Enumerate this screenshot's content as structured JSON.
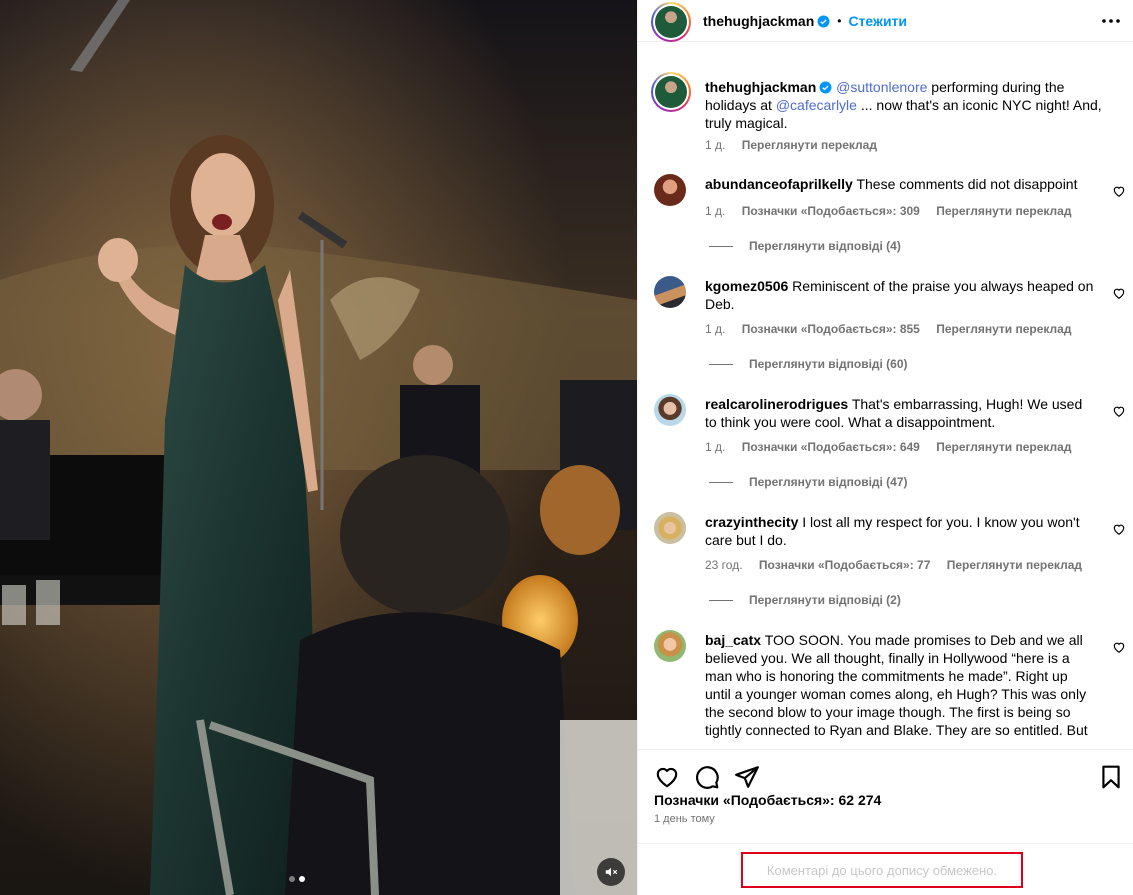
{
  "post": {
    "username": "thehughjackman",
    "follow_label": "Стежити",
    "caption": {
      "mention_1": "@suttonlenore",
      "text_1": " performing during the holidays at ",
      "mention_2": "@cafecarlyle",
      "text_2": " ... now that's an iconic NYC night! And, truly magical.",
      "time": "1 д.",
      "translate": "Переглянути переклад"
    }
  },
  "comments": [
    {
      "username": "abundanceofaprilkelly",
      "text": "These comments did not disappoint",
      "time": "1 д.",
      "likes": "Позначки «Подобається»: 309",
      "translate": "Переглянути переклад",
      "replies": "Переглянути відповіді (4)"
    },
    {
      "username": "kgomez0506",
      "text": "Reminiscent of the praise you always heaped on Deb.",
      "time": "1 д.",
      "likes": "Позначки «Подобається»: 855",
      "translate": "Переглянути переклад",
      "replies": "Переглянути відповіді (60)"
    },
    {
      "username": "realcarolinerodrigues",
      "text": "That's embarrassing, Hugh! We used to think you were cool. What a disappointment.",
      "time": "1 д.",
      "likes": "Позначки «Подобається»: 649",
      "translate": "Переглянути переклад",
      "replies": "Переглянути відповіді (47)"
    },
    {
      "username": "crazyinthecity",
      "text": "I lost all my respect for you. I know you won't care but I do.",
      "time": "23 год.",
      "likes": "Позначки «Подобається»: 77",
      "translate": "Переглянути переклад",
      "replies": "Переглянути відповіді (2)"
    },
    {
      "username": "baj_catx",
      "text": "TOO SOON. You made promises to Deb and we all believed you. We all thought, finally in Hollywood “here is a man who is honoring the commitments he made”. Right up until a younger woman comes along, eh Hugh? This was only the second blow to your image though. The first is being so tightly connected to Ryan and Blake. They are so entitled. But"
    }
  ],
  "actions": {
    "likes": "Позначки «Подобається»: 62 274",
    "date": "1 день тому"
  },
  "footer": {
    "limited_text": "Коментарі до цього допису обмежено."
  },
  "media": {
    "carousel_count": 2,
    "carousel_active": 2
  },
  "colors": {
    "accent": "#0095f6",
    "mention": "#4f6bd5",
    "secondary_text": "#737373",
    "highlight_border": "#e0001b"
  }
}
